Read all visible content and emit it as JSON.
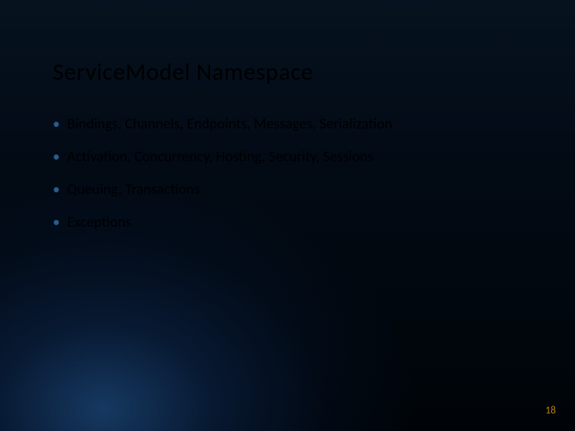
{
  "title": "ServiceModel Namespace",
  "bullets": [
    "Bindings, Channels, Endpoints, Messages, Serialization",
    "Activation, Concurrency, Hosting, Security, Sessions",
    "Queuing, Transactions",
    "Exceptions"
  ],
  "page_number": "18"
}
